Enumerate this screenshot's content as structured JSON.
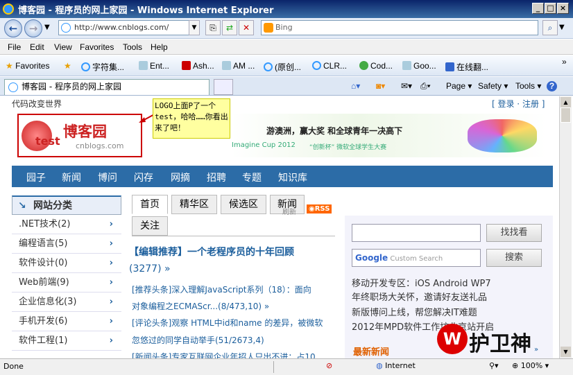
{
  "window": {
    "title": "博客园 - 程序员的网上家园 - Windows Internet Explorer"
  },
  "nav": {
    "address": "http://www.cnblogs.com/",
    "search_placeholder": "Bing"
  },
  "menu": [
    "File",
    "Edit",
    "View",
    "Favorites",
    "Tools",
    "Help"
  ],
  "favorites": {
    "label": "Favorites",
    "items": [
      "字符集...",
      "Ent...",
      "Ash...",
      "AM ...",
      "(原创...",
      "CLR...",
      "Cod...",
      "Goo...",
      "在线翻..."
    ]
  },
  "tab": {
    "title": "博客园 - 程序员的网上家园"
  },
  "toolbar": {
    "page": "Page",
    "safety": "Safety",
    "tools": "Tools"
  },
  "site": {
    "slogan": "代码改变世界",
    "login": "[ 登录 · 注册 ]",
    "logo_text": "博客园",
    "logo_sub": "test",
    "logo_domain": "cnblogs.com",
    "callout": "LOGO上面P了一个test，哈哈……你看出来了吧！",
    "banner": {
      "headline": "游澳洲，赢大奖 和全球青年一决高下",
      "sub_brand": "Imagine Cup 2012",
      "sub": "“创新杯” 微软全球学生大赛"
    },
    "nav_items": [
      "园子",
      "新闻",
      "博问",
      "闪存",
      "网摘",
      "招聘",
      "专题",
      "知识库"
    ],
    "sidebar_title": "网站分类",
    "categories": [
      ".NET技术(2)",
      "编程语言(5)",
      "软件设计(0)",
      "Web前端(9)",
      "企业信息化(3)",
      "手机开发(6)",
      "软件工程(1)"
    ],
    "tabs": [
      "首页",
      "精华区",
      "候选区",
      "新闻",
      "关注"
    ],
    "refresh": "刷新",
    "rss": "RSS",
    "featured": "【编辑推荐】一个老程序员的十年回顾",
    "featured_count": "(3277) »",
    "headlines": [
      "[推荐头条]深入理解JavaScript系列（18）：面向",
      "对象编程之ECMAScr...(8/473,10) »",
      "[评论头条]观察 HTML中id和name 的差异，被微软",
      "忽悠过的同学自动举手(51/2673,4)",
      "[新闻头条]专家互联网企业年招人只出不进：占10"
    ],
    "search_btn": "找找看",
    "search_btn2": "搜索",
    "google_placeholder": "Custom Search",
    "right_links": [
      "移动开发专区：iOS  Android  WP7",
      "年终职场大关怀，邀请好友送礼品",
      "新版博问上线，帮您解决IT难题",
      "2012年MPD软件工作坊北京站开启"
    ],
    "latest_news": "最新新闻",
    "watermark": "护卫神"
  },
  "status": {
    "text": "Done",
    "zone": "Internet",
    "zoom": "100%"
  }
}
